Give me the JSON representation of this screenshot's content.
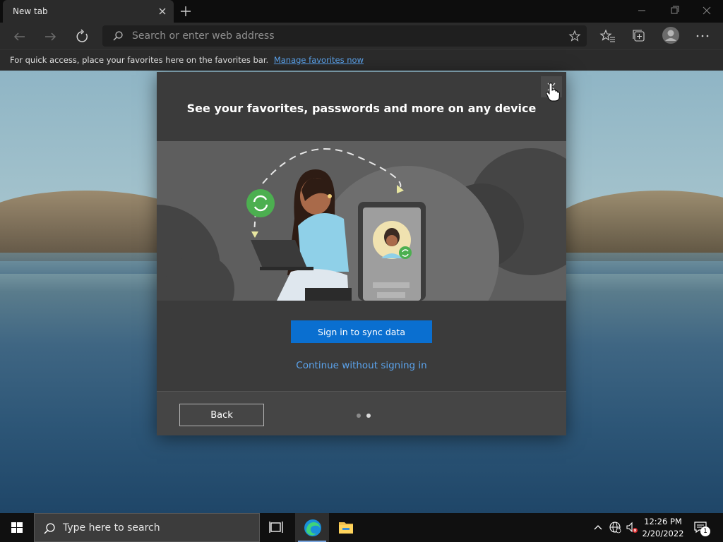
{
  "browser": {
    "tab_title": "New tab",
    "address_placeholder": "Search or enter web address",
    "favorites_bar_text": "For quick access, place your favorites here on the favorites bar.",
    "favorites_bar_link": "Manage favorites now"
  },
  "dialog": {
    "title": "See your favorites, passwords and more on any device",
    "primary_button": "Sign in to sync data",
    "secondary_link": "Continue without signing in",
    "back_button": "Back",
    "pager": {
      "total_pages": 2,
      "current_page": 2
    }
  },
  "taskbar": {
    "search_placeholder": "Type here to search",
    "clock_time": "12:26 PM",
    "clock_date": "2/20/2022",
    "notification_count": "1"
  },
  "colors": {
    "accent_blue": "#0a6fd0",
    "link_blue": "#5ba3ec",
    "sync_green": "#4caf50"
  }
}
